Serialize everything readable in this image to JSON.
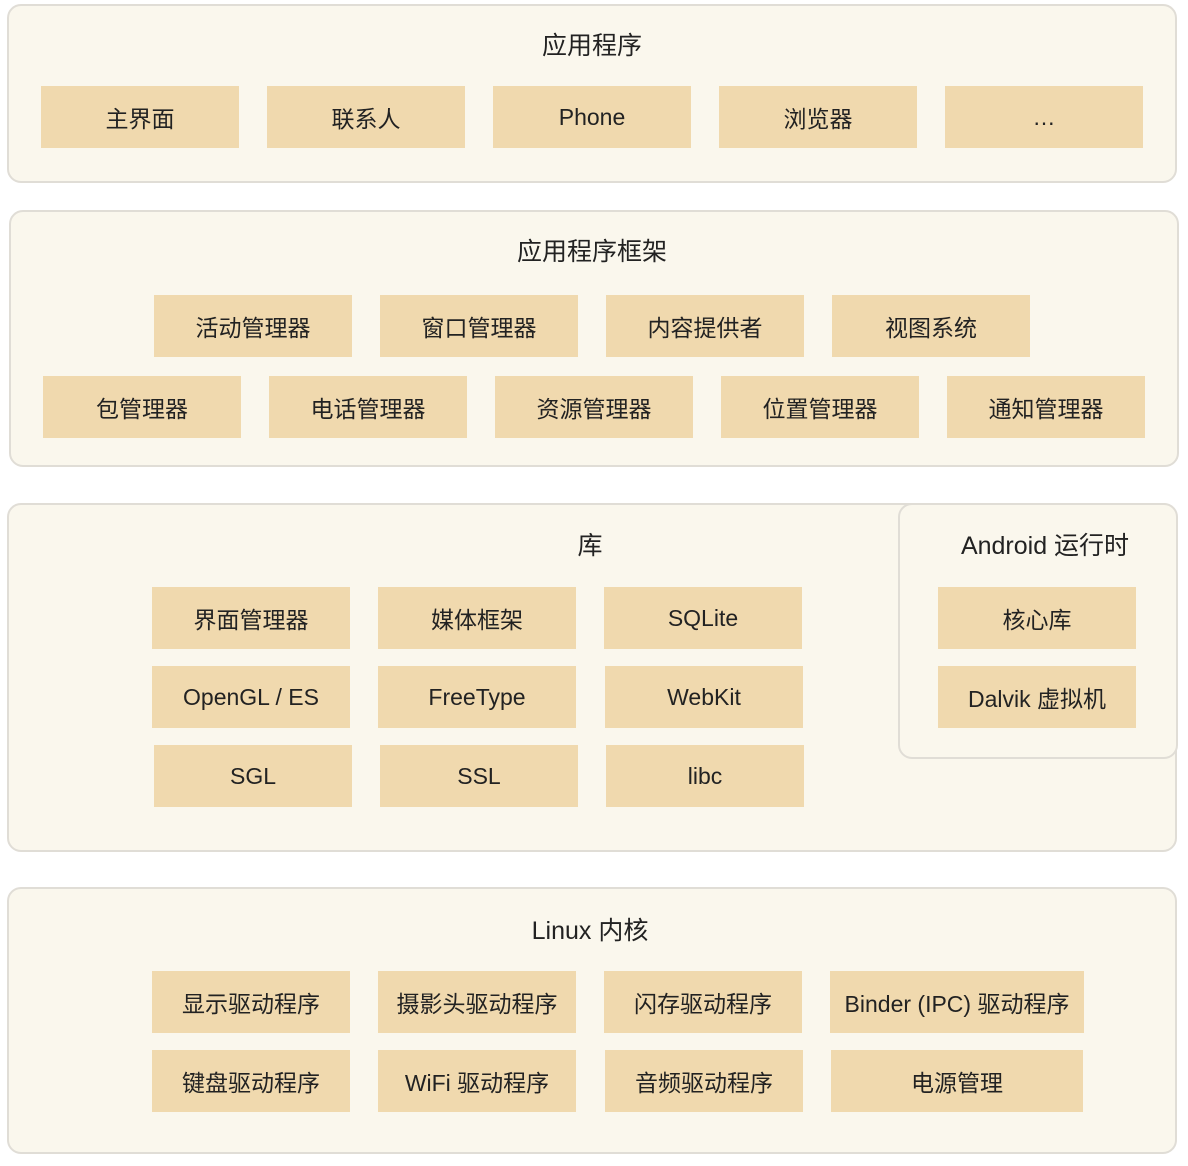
{
  "colors": {
    "panel_bg": "#faf7ed",
    "panel_border": "#e0ddd6",
    "box_bg": "#f0d9ae",
    "text": "#222222"
  },
  "layers": {
    "applications": {
      "title": "应用程序",
      "items": [
        "主界面",
        "联系人",
        "Phone",
        "浏览器",
        "…"
      ]
    },
    "framework": {
      "title": "应用程序框架",
      "row1": [
        "活动管理器",
        "窗口管理器",
        "内容提供者",
        "视图系统"
      ],
      "row2": [
        "包管理器",
        "电话管理器",
        "资源管理器",
        "位置管理器",
        "通知管理器"
      ]
    },
    "libraries": {
      "title": "库",
      "rows": [
        [
          "界面管理器",
          "媒体框架",
          "SQLite"
        ],
        [
          "OpenGL / ES",
          "FreeType",
          "WebKit"
        ],
        [
          "SGL",
          "SSL",
          "libc"
        ]
      ]
    },
    "runtime": {
      "title": "Android 运行时",
      "items": [
        "核心库",
        "Dalvik 虚拟机"
      ]
    },
    "kernel": {
      "title": "Linux 内核",
      "row1": [
        "显示驱动程序",
        "摄影头驱动程序",
        "闪存驱动程序",
        "Binder (IPC) 驱动程序"
      ],
      "row2": [
        "键盘驱动程序",
        "WiFi 驱动程序",
        "音频驱动程序",
        "电源管理"
      ]
    }
  }
}
